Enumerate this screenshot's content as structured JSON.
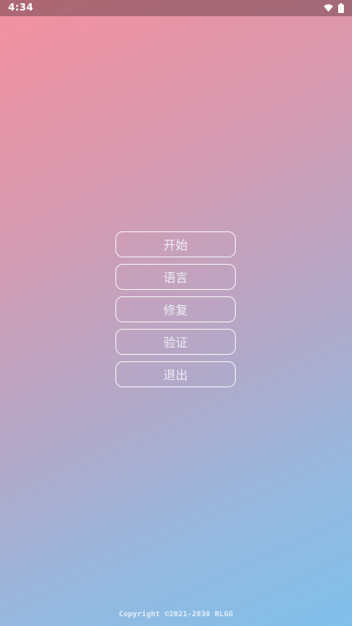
{
  "status_bar": {
    "time": "4:34",
    "icons": [
      "wifi-icon",
      "battery-icon"
    ]
  },
  "menu": {
    "items": [
      {
        "label": "开始"
      },
      {
        "label": "语言"
      },
      {
        "label": "修复"
      },
      {
        "label": "验证"
      },
      {
        "label": "退出"
      }
    ]
  },
  "footer": {
    "copyright": "Copyright ©2021-2030 RLGG"
  },
  "colors": {
    "gradient_top": "#f4909f",
    "gradient_bottom": "#7fc0ea",
    "button_border": "#ffffff",
    "text": "#f0f4fa"
  }
}
